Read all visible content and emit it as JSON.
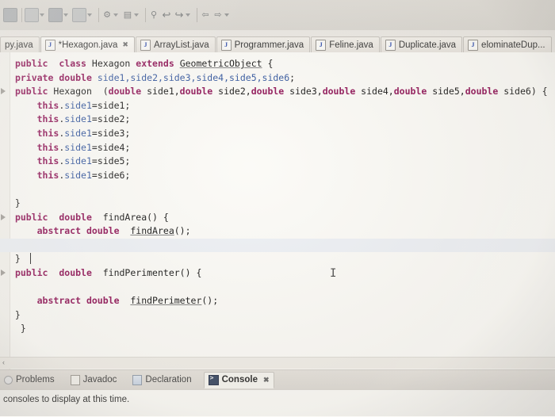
{
  "toolbar": {
    "items": [
      {
        "name": "save-icon",
        "glyph": "■"
      },
      {
        "name": "debug-icon",
        "glyph": "▶"
      },
      {
        "name": "run-icon",
        "glyph": "●"
      },
      {
        "name": "coverage-icon",
        "glyph": "■"
      },
      {
        "name": "external-tools-icon",
        "glyph": "⚙"
      },
      {
        "name": "new-icon",
        "glyph": "▤"
      },
      {
        "name": "search-icon",
        "glyph": "⌕"
      },
      {
        "name": "back-icon",
        "glyph": "↩"
      },
      {
        "name": "forward-icon",
        "glyph": "↪"
      },
      {
        "name": "prev-icon",
        "glyph": "⇦"
      },
      {
        "name": "next-icon",
        "glyph": "⇨"
      }
    ]
  },
  "tabs": [
    {
      "label": "py.java",
      "icon": "java-file-icon",
      "dirty": false,
      "active": false,
      "closable": false
    },
    {
      "label": "*Hexagon.java",
      "icon": "java-file-icon",
      "dirty": true,
      "active": true,
      "closable": true
    },
    {
      "label": "ArrayList.java",
      "icon": "java-file-icon",
      "dirty": false,
      "active": false,
      "closable": false
    },
    {
      "label": "Programmer.java",
      "icon": "java-file-icon",
      "dirty": false,
      "active": false,
      "closable": false
    },
    {
      "label": "Feline.java",
      "icon": "java-file-icon",
      "dirty": false,
      "active": false,
      "closable": false
    },
    {
      "label": "Duplicate.java",
      "icon": "java-file-icon",
      "dirty": false,
      "active": false,
      "closable": false
    },
    {
      "label": "elominateDup...",
      "icon": "java-file-icon",
      "dirty": false,
      "active": false,
      "closable": false
    }
  ],
  "editor": {
    "caret_line": 15,
    "lines": [
      {
        "marker": false,
        "highlight": false,
        "segments": [
          {
            "t": " ",
            "c": "plain"
          },
          {
            "t": "public",
            "c": "kw"
          },
          {
            "t": "  ",
            "c": "plain"
          },
          {
            "t": "class",
            "c": "kw"
          },
          {
            "t": " Hexagon ",
            "c": "plain"
          },
          {
            "t": "extends",
            "c": "kw"
          },
          {
            "t": " ",
            "c": "plain"
          },
          {
            "t": "GeometricObject",
            "c": "und"
          },
          {
            "t": " {",
            "c": "plain"
          }
        ]
      },
      {
        "marker": false,
        "highlight": false,
        "segments": [
          {
            "t": " ",
            "c": "plain"
          },
          {
            "t": "private",
            "c": "kw"
          },
          {
            "t": " ",
            "c": "plain"
          },
          {
            "t": "double",
            "c": "kw"
          },
          {
            "t": " ",
            "c": "plain"
          },
          {
            "t": "side1,side2,side3,side4,side5,side6",
            "c": "fld"
          },
          {
            "t": ";",
            "c": "plain"
          }
        ]
      },
      {
        "marker": true,
        "highlight": false,
        "segments": [
          {
            "t": " ",
            "c": "plain"
          },
          {
            "t": "public",
            "c": "kw"
          },
          {
            "t": " Hexagon  (",
            "c": "plain"
          },
          {
            "t": "double",
            "c": "kw"
          },
          {
            "t": " side1,",
            "c": "plain"
          },
          {
            "t": "double",
            "c": "kw"
          },
          {
            "t": " side2,",
            "c": "plain"
          },
          {
            "t": "double",
            "c": "kw"
          },
          {
            "t": " side3,",
            "c": "plain"
          },
          {
            "t": "double",
            "c": "kw"
          },
          {
            "t": " side4,",
            "c": "plain"
          },
          {
            "t": "double",
            "c": "kw"
          },
          {
            "t": " side5,",
            "c": "plain"
          },
          {
            "t": "double",
            "c": "kw"
          },
          {
            "t": " side6) {",
            "c": "plain"
          }
        ]
      },
      {
        "marker": false,
        "highlight": false,
        "segments": [
          {
            "t": "     ",
            "c": "plain"
          },
          {
            "t": "this",
            "c": "kw"
          },
          {
            "t": ".",
            "c": "plain"
          },
          {
            "t": "side1",
            "c": "fld"
          },
          {
            "t": "=side1;",
            "c": "plain"
          }
        ]
      },
      {
        "marker": false,
        "highlight": false,
        "segments": [
          {
            "t": "     ",
            "c": "plain"
          },
          {
            "t": "this",
            "c": "kw"
          },
          {
            "t": ".",
            "c": "plain"
          },
          {
            "t": "side1",
            "c": "fld"
          },
          {
            "t": "=side2;",
            "c": "plain"
          }
        ]
      },
      {
        "marker": false,
        "highlight": false,
        "segments": [
          {
            "t": "     ",
            "c": "plain"
          },
          {
            "t": "this",
            "c": "kw"
          },
          {
            "t": ".",
            "c": "plain"
          },
          {
            "t": "side1",
            "c": "fld"
          },
          {
            "t": "=side3;",
            "c": "plain"
          }
        ]
      },
      {
        "marker": false,
        "highlight": false,
        "segments": [
          {
            "t": "     ",
            "c": "plain"
          },
          {
            "t": "this",
            "c": "kw"
          },
          {
            "t": ".",
            "c": "plain"
          },
          {
            "t": "side1",
            "c": "fld"
          },
          {
            "t": "=side4;",
            "c": "plain"
          }
        ]
      },
      {
        "marker": false,
        "highlight": false,
        "segments": [
          {
            "t": "     ",
            "c": "plain"
          },
          {
            "t": "this",
            "c": "kw"
          },
          {
            "t": ".",
            "c": "plain"
          },
          {
            "t": "side1",
            "c": "fld"
          },
          {
            "t": "=side5;",
            "c": "plain"
          }
        ]
      },
      {
        "marker": false,
        "highlight": false,
        "segments": [
          {
            "t": "     ",
            "c": "plain"
          },
          {
            "t": "this",
            "c": "kw"
          },
          {
            "t": ".",
            "c": "plain"
          },
          {
            "t": "side1",
            "c": "fld"
          },
          {
            "t": "=side6;",
            "c": "plain"
          }
        ]
      },
      {
        "marker": false,
        "highlight": false,
        "segments": [
          {
            "t": "",
            "c": "plain"
          }
        ]
      },
      {
        "marker": false,
        "highlight": false,
        "segments": [
          {
            "t": " }",
            "c": "plain"
          }
        ]
      },
      {
        "marker": true,
        "highlight": false,
        "segments": [
          {
            "t": " ",
            "c": "plain"
          },
          {
            "t": "public",
            "c": "kw"
          },
          {
            "t": "  ",
            "c": "plain"
          },
          {
            "t": "double",
            "c": "kw"
          },
          {
            "t": "  findArea() {",
            "c": "plain"
          }
        ]
      },
      {
        "marker": false,
        "highlight": false,
        "segments": [
          {
            "t": "     ",
            "c": "plain"
          },
          {
            "t": "abstract",
            "c": "kw"
          },
          {
            "t": " ",
            "c": "plain"
          },
          {
            "t": "double",
            "c": "kw"
          },
          {
            "t": "  ",
            "c": "plain"
          },
          {
            "t": "findArea",
            "c": "und"
          },
          {
            "t": "();",
            "c": "plain"
          }
        ]
      },
      {
        "marker": false,
        "highlight": true,
        "segments": [
          {
            "t": "",
            "c": "plain"
          }
        ]
      },
      {
        "marker": false,
        "highlight": false,
        "segments": [
          {
            "t": " }",
            "c": "plain"
          }
        ]
      },
      {
        "marker": true,
        "highlight": false,
        "segments": [
          {
            "t": " ",
            "c": "plain"
          },
          {
            "t": "public",
            "c": "kw"
          },
          {
            "t": "  ",
            "c": "plain"
          },
          {
            "t": "double",
            "c": "kw"
          },
          {
            "t": "  findPerimenter() {",
            "c": "plain"
          }
        ]
      },
      {
        "marker": false,
        "highlight": false,
        "segments": [
          {
            "t": "",
            "c": "plain"
          }
        ]
      },
      {
        "marker": false,
        "highlight": false,
        "segments": [
          {
            "t": "     ",
            "c": "plain"
          },
          {
            "t": "abstract",
            "c": "kw"
          },
          {
            "t": " ",
            "c": "plain"
          },
          {
            "t": "double",
            "c": "kw"
          },
          {
            "t": "  ",
            "c": "plain"
          },
          {
            "t": "findPerimeter",
            "c": "und"
          },
          {
            "t": "();",
            "c": "plain"
          }
        ]
      },
      {
        "marker": false,
        "highlight": false,
        "segments": [
          {
            "t": " }",
            "c": "plain"
          }
        ]
      },
      {
        "marker": false,
        "highlight": false,
        "segments": [
          {
            "t": "  }",
            "c": "plain"
          }
        ]
      }
    ]
  },
  "view_tabs": [
    {
      "label": "Problems",
      "icon": "problems-icon",
      "active": false,
      "closable": false
    },
    {
      "label": "Javadoc",
      "icon": "javadoc-icon",
      "active": false,
      "closable": false
    },
    {
      "label": "Declaration",
      "icon": "declaration-icon",
      "active": false,
      "closable": false
    },
    {
      "label": "Console",
      "icon": "console-icon",
      "active": true,
      "closable": true
    }
  ],
  "console": {
    "message": "consoles to display at this time."
  },
  "scrollbar": {
    "left_arrow": "‹"
  },
  "colors": {
    "keyword": "#8b0a50",
    "field": "#2a4f9a",
    "editor_bg": "#fbfaf6",
    "chrome_bg": "#dfdcd6",
    "highlight_line": "#eceff4"
  }
}
